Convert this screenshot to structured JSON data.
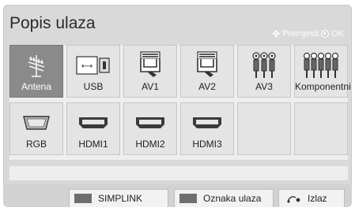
{
  "header": {
    "title": "Popis ulaza",
    "hint_move": "Premjesti",
    "hint_ok": "OK"
  },
  "inputs": [
    {
      "label": "Antena",
      "icon": "antenna-icon",
      "selected": true
    },
    {
      "label": "USB",
      "icon": "usb-icon",
      "selected": false
    },
    {
      "label": "AV1",
      "icon": "scart-icon",
      "selected": false
    },
    {
      "label": "AV2",
      "icon": "scart-icon",
      "selected": false
    },
    {
      "label": "AV3",
      "icon": "rca-icon",
      "selected": false
    },
    {
      "label": "Komponentni",
      "icon": "component-icon",
      "selected": false
    },
    {
      "label": "RGB",
      "icon": "vga-icon",
      "selected": false
    },
    {
      "label": "HDMI1",
      "icon": "hdmi-icon",
      "selected": false
    },
    {
      "label": "HDMI2",
      "icon": "hdmi-icon",
      "selected": false
    },
    {
      "label": "HDMI3",
      "icon": "hdmi-icon",
      "selected": false
    }
  ],
  "footer": {
    "simplink": "SIMPLINK",
    "label_input": "Oznaka ulaza",
    "exit": "Izlaz"
  },
  "colors": {
    "selected": "#8a8a8a",
    "panel": "#d9d9d9"
  }
}
